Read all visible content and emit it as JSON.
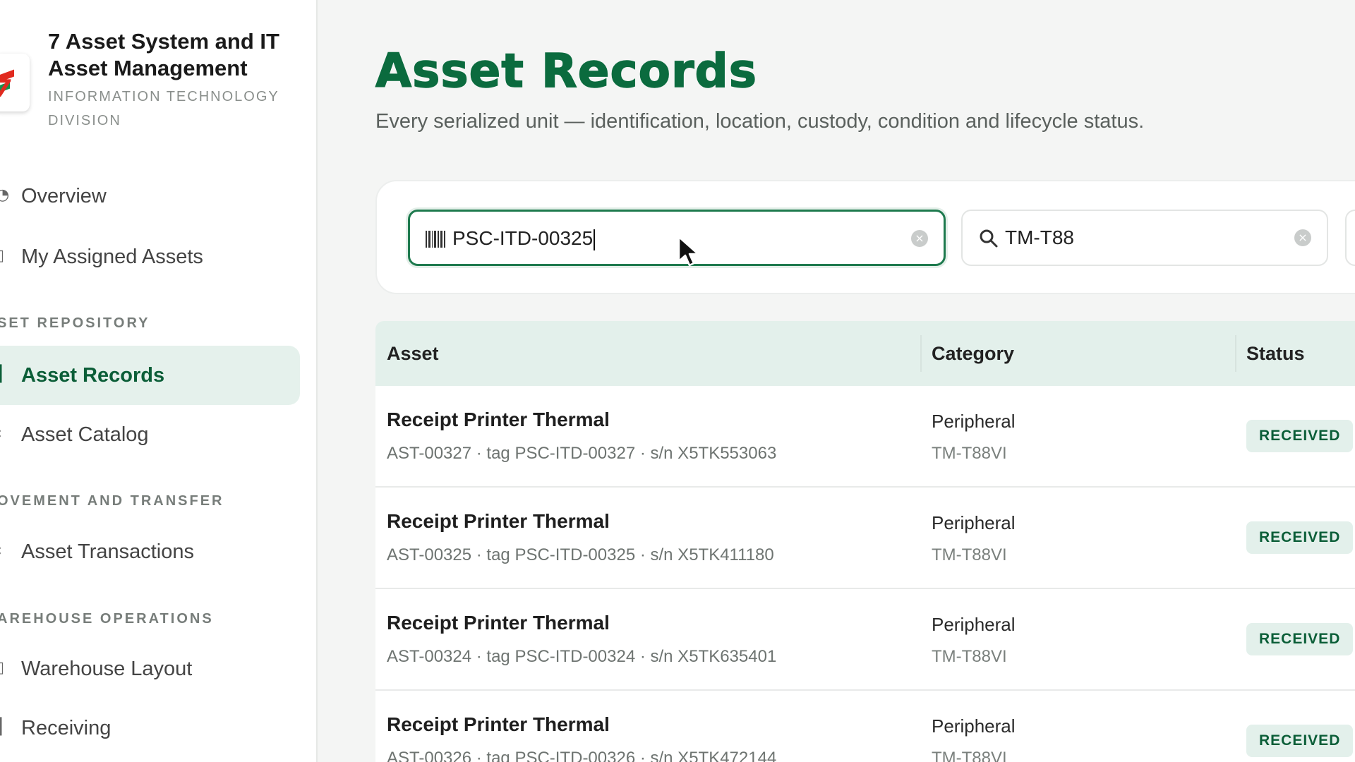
{
  "sidebar": {
    "brand_title": "7 Asset System and IT Asset Management",
    "brand_subtitle": "INFORMATION TECHNOLOGY DIVISION",
    "items_top": [
      {
        "label": "Overview"
      },
      {
        "label": "My Assigned Assets"
      }
    ],
    "sections": [
      {
        "label": "SET REPOSITORY",
        "items": [
          {
            "label": "Asset Records",
            "active": true
          },
          {
            "label": "Asset Catalog"
          }
        ]
      },
      {
        "label": "OVEMENT AND TRANSFER",
        "items": [
          {
            "label": "Asset Transactions"
          }
        ]
      },
      {
        "label": "AREHOUSE OPERATIONS",
        "items": [
          {
            "label": "Warehouse Layout"
          },
          {
            "label": "Receiving"
          }
        ]
      }
    ]
  },
  "main": {
    "title": "Asset Records",
    "subtitle": "Every serialized unit — identification, location, custody, condition and lifecycle status."
  },
  "filters": {
    "tag_input_value": "PSC-ITD-00325",
    "search_input_value": "TM-T88"
  },
  "table": {
    "columns": [
      "Asset",
      "Category",
      "Status"
    ],
    "rows": [
      {
        "name": "Receipt Printer Thermal",
        "meta": "AST-00327 · tag PSC-ITD-00327 · s/n X5TK553063",
        "category": "Peripheral",
        "model": "TM-T88VI",
        "status": "RECEIVED"
      },
      {
        "name": "Receipt Printer Thermal",
        "meta": "AST-00325 · tag PSC-ITD-00325 · s/n X5TK411180",
        "category": "Peripheral",
        "model": "TM-T88VI",
        "status": "RECEIVED"
      },
      {
        "name": "Receipt Printer Thermal",
        "meta": "AST-00324 · tag PSC-ITD-00324 · s/n X5TK635401",
        "category": "Peripheral",
        "model": "TM-T88VI",
        "status": "RECEIVED"
      },
      {
        "name": "Receipt Printer Thermal",
        "meta": "AST-00326 · tag PSC-ITD-00326 · s/n X5TK472144",
        "category": "Peripheral",
        "model": "TM-T88VI",
        "status": "RECEIVED"
      }
    ]
  },
  "colors": {
    "accent": "#0b6b3e",
    "active_bg": "#e5f1ec",
    "status_badge_bg": "#e3f0eb"
  }
}
